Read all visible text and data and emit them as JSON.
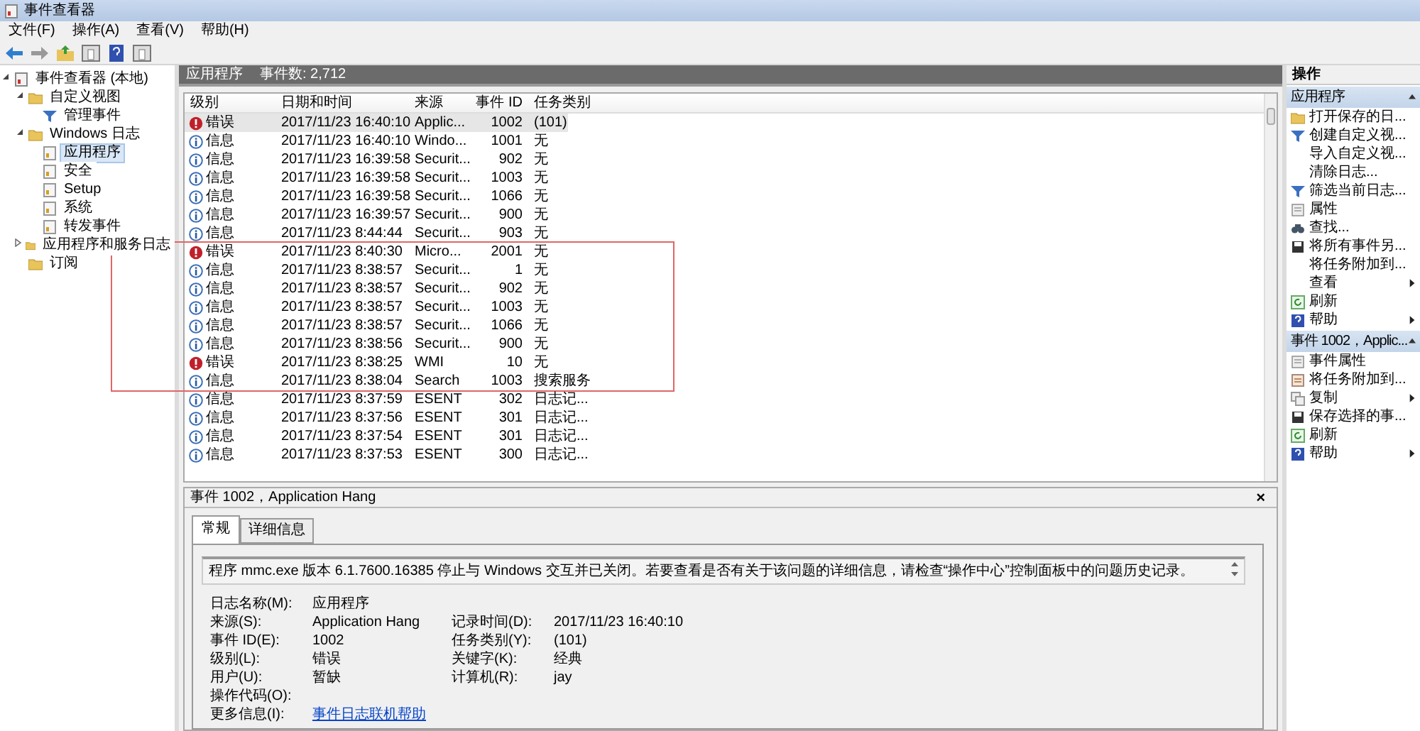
{
  "window": {
    "title": "事件查看器"
  },
  "menu": [
    "文件(F)",
    "操作(A)",
    "查看(V)",
    "帮助(H)"
  ],
  "tree": [
    {
      "label": "事件查看器 (本地)",
      "kind": "viewer",
      "selected": false,
      "expanded": true,
      "children": [
        {
          "label": "自定义视图",
          "kind": "folder",
          "selected": false,
          "expanded": true,
          "children": [
            {
              "label": "管理事件",
              "kind": "filter",
              "selected": false
            }
          ]
        },
        {
          "label": "Windows 日志",
          "kind": "folder",
          "selected": false,
          "expanded": true,
          "children": [
            {
              "label": "应用程序",
              "kind": "log",
              "selected": true
            },
            {
              "label": "安全",
              "kind": "log",
              "selected": false
            },
            {
              "label": "Setup",
              "kind": "log",
              "selected": false
            },
            {
              "label": "系统",
              "kind": "log",
              "selected": false
            },
            {
              "label": "转发事件",
              "kind": "log",
              "selected": false
            }
          ]
        },
        {
          "label": "应用程序和服务日志",
          "kind": "folder",
          "selected": false,
          "expanded": false
        },
        {
          "label": "订阅",
          "kind": "folder",
          "selected": false
        }
      ]
    }
  ],
  "list_header": {
    "title": "应用程序",
    "count": "事件数: 2,712"
  },
  "table": {
    "columns": [
      "级别",
      "日期和时间",
      "来源",
      "事件 ID",
      "任务类别"
    ],
    "rows": [
      {
        "kind": "error",
        "level": "错误",
        "date": "2017/11/23 16:40:10",
        "source": "Applic...",
        "id": "1002",
        "category": "(101)",
        "selected": true,
        "boxed": false
      },
      {
        "kind": "info",
        "level": "信息",
        "date": "2017/11/23 16:40:10",
        "source": "Windo...",
        "id": "1001",
        "category": "无",
        "selected": false,
        "boxed": false
      },
      {
        "kind": "info",
        "level": "信息",
        "date": "2017/11/23 16:39:58",
        "source": "Securit...",
        "id": "902",
        "category": "无",
        "selected": false,
        "boxed": false
      },
      {
        "kind": "info",
        "level": "信息",
        "date": "2017/11/23 16:39:58",
        "source": "Securit...",
        "id": "1003",
        "category": "无",
        "selected": false,
        "boxed": false
      },
      {
        "kind": "info",
        "level": "信息",
        "date": "2017/11/23 16:39:58",
        "source": "Securit...",
        "id": "1066",
        "category": "无",
        "selected": false,
        "boxed": false
      },
      {
        "kind": "info",
        "level": "信息",
        "date": "2017/11/23 16:39:57",
        "source": "Securit...",
        "id": "900",
        "category": "无",
        "selected": false,
        "boxed": false
      },
      {
        "kind": "info",
        "level": "信息",
        "date": "2017/11/23 8:44:44",
        "source": "Securit...",
        "id": "903",
        "category": "无",
        "selected": false,
        "boxed": false
      },
      {
        "kind": "error",
        "level": "错误",
        "date": "2017/11/23 8:40:30",
        "source": "Micro...",
        "id": "2001",
        "category": "无",
        "selected": false,
        "boxed": true
      },
      {
        "kind": "info",
        "level": "信息",
        "date": "2017/11/23 8:38:57",
        "source": "Securit...",
        "id": "1",
        "category": "无",
        "selected": false,
        "boxed": true
      },
      {
        "kind": "info",
        "level": "信息",
        "date": "2017/11/23 8:38:57",
        "source": "Securit...",
        "id": "902",
        "category": "无",
        "selected": false,
        "boxed": true
      },
      {
        "kind": "info",
        "level": "信息",
        "date": "2017/11/23 8:38:57",
        "source": "Securit...",
        "id": "1003",
        "category": "无",
        "selected": false,
        "boxed": true
      },
      {
        "kind": "info",
        "level": "信息",
        "date": "2017/11/23 8:38:57",
        "source": "Securit...",
        "id": "1066",
        "category": "无",
        "selected": false,
        "boxed": true
      },
      {
        "kind": "info",
        "level": "信息",
        "date": "2017/11/23 8:38:56",
        "source": "Securit...",
        "id": "900",
        "category": "无",
        "selected": false,
        "boxed": true
      },
      {
        "kind": "error",
        "level": "错误",
        "date": "2017/11/23 8:38:25",
        "source": "WMI",
        "id": "10",
        "category": "无",
        "selected": false,
        "boxed": true
      },
      {
        "kind": "info",
        "level": "信息",
        "date": "2017/11/23 8:38:04",
        "source": "Search",
        "id": "1003",
        "category": "搜索服务",
        "selected": false,
        "boxed": true
      },
      {
        "kind": "info",
        "level": "信息",
        "date": "2017/11/23 8:37:59",
        "source": "ESENT",
        "id": "302",
        "category": "日志记...",
        "selected": false,
        "boxed": false
      },
      {
        "kind": "info",
        "level": "信息",
        "date": "2017/11/23 8:37:56",
        "source": "ESENT",
        "id": "301",
        "category": "日志记...",
        "selected": false,
        "boxed": false
      },
      {
        "kind": "info",
        "level": "信息",
        "date": "2017/11/23 8:37:54",
        "source": "ESENT",
        "id": "301",
        "category": "日志记...",
        "selected": false,
        "boxed": false
      },
      {
        "kind": "info",
        "level": "信息",
        "date": "2017/11/23 8:37:53",
        "source": "ESENT",
        "id": "300",
        "category": "日志记...",
        "selected": false,
        "boxed": false
      }
    ]
  },
  "detail": {
    "title": "事件 1002，Application Hang",
    "close": "×",
    "tabs": [
      {
        "label": "常规",
        "selected": true
      },
      {
        "label": "详细信息",
        "selected": false
      }
    ],
    "message": "程序 mmc.exe 版本 6.1.7600.16385 停止与 Windows 交互并已关闭。若要查看是否有关于该问题的详细信息，请检查“操作中心”控制面板中的问题历史记录。",
    "fields": [
      {
        "label": "日志名称(M):",
        "value": "应用程序"
      },
      {
        "label": "来源(S):",
        "value": "Application Hang",
        "label2": "记录时间(D):",
        "value2": "2017/11/23 16:40:10"
      },
      {
        "label": "事件 ID(E):",
        "value": "1002",
        "label2": "任务类别(Y):",
        "value2": "(101)"
      },
      {
        "label": "级别(L):",
        "value": "错误",
        "label2": "关键字(K):",
        "value2": "经典"
      },
      {
        "label": "用户(U):",
        "value": "暂缺",
        "label2": "计算机(R):",
        "value2": "jay"
      },
      {
        "label": "操作代码(O):"
      },
      {
        "label": "更多信息(I):",
        "link": "事件日志联机帮助"
      }
    ]
  },
  "actions": {
    "title": "操作",
    "sections": [
      {
        "title": "应用程序",
        "expanded": true,
        "items": [
          {
            "label": "打开保存的日...",
            "kind": "folder",
            "submenu": false
          },
          {
            "label": "创建自定义视...",
            "kind": "filter",
            "submenu": false
          },
          {
            "label": "导入自定义视...",
            "kind": "plain",
            "submenu": false
          },
          {
            "label": "清除日志...",
            "kind": "plain",
            "submenu": false
          },
          {
            "label": "筛选当前日志...",
            "kind": "filter",
            "submenu": false
          },
          {
            "label": "属性",
            "kind": "sheet",
            "submenu": false
          },
          {
            "label": "查找...",
            "kind": "find",
            "submenu": false
          },
          {
            "label": "将所有事件另...",
            "kind": "save",
            "submenu": false
          },
          {
            "label": "将任务附加到...",
            "kind": "plain",
            "submenu": false
          },
          {
            "label": "查看",
            "kind": "plain",
            "submenu": true
          },
          {
            "label": "刷新",
            "kind": "refresh",
            "submenu": false
          },
          {
            "label": "帮助",
            "kind": "help",
            "submenu": true
          }
        ]
      },
      {
        "title": "事件 1002，Applic...",
        "expanded": true,
        "items": [
          {
            "label": "事件属性",
            "kind": "sheet",
            "submenu": false
          },
          {
            "label": "将任务附加到...",
            "kind": "task",
            "submenu": false
          },
          {
            "label": "复制",
            "kind": "copy",
            "submenu": true
          },
          {
            "label": "保存选择的事...",
            "kind": "save",
            "submenu": false
          },
          {
            "label": "刷新",
            "kind": "refresh",
            "submenu": false
          },
          {
            "label": "帮助",
            "kind": "help",
            "submenu": true
          }
        ]
      }
    ]
  }
}
